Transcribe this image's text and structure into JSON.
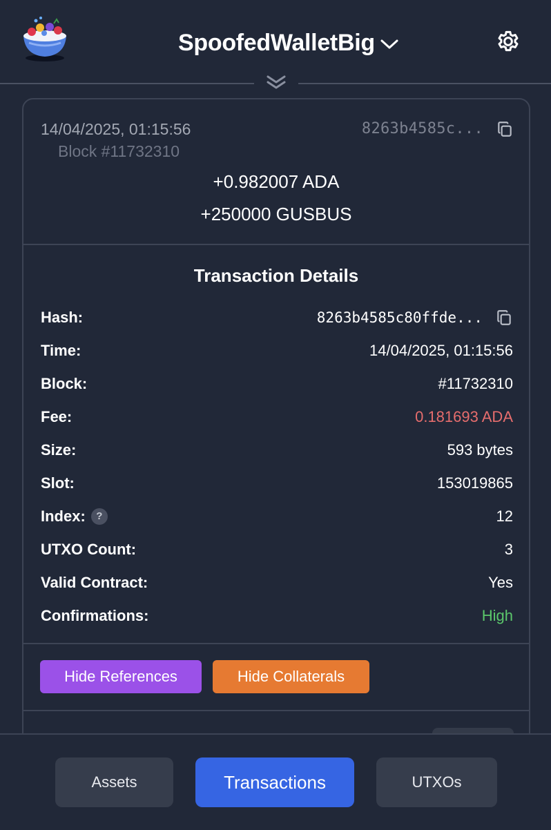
{
  "header": {
    "wallet_name": "SpoofedWalletBig",
    "icons": {
      "logo": "bowl-logo",
      "switch": "chevron-down-icon",
      "settings": "gear-icon",
      "collapse": "double-chevron-down-icon"
    }
  },
  "transaction": {
    "time": "14/04/2025, 01:15:56",
    "block": "Block #11732310",
    "hash_short": "8263b4585c...",
    "amounts": [
      "+0.982007 ADA",
      "+250000 GUSBUS"
    ]
  },
  "details": {
    "title": "Transaction Details",
    "rows": [
      {
        "label": "Hash:",
        "value": "8263b4585c80ffde..."
      },
      {
        "label": "Time:",
        "value": "14/04/2025, 01:15:56"
      },
      {
        "label": "Block:",
        "value": "#11732310"
      },
      {
        "label": "Fee:",
        "value": "0.181693 ADA"
      },
      {
        "label": "Size:",
        "value": "593 bytes"
      },
      {
        "label": "Slot:",
        "value": "153019865"
      },
      {
        "label": "Index:",
        "value": "12",
        "help": "?"
      },
      {
        "label": "UTXO Count:",
        "value": "3"
      },
      {
        "label": "Valid Contract:",
        "value": "Yes"
      },
      {
        "label": "Confirmations:",
        "value": "High"
      }
    ]
  },
  "actions": {
    "hide_references": "Hide References",
    "hide_collaterals": "Hide Collaterals"
  },
  "nav": {
    "tabs": [
      "Assets",
      "Transactions",
      "UTXOs"
    ],
    "active": "Transactions"
  },
  "colors": {
    "background": "#212838",
    "fee": "#e66d6d",
    "confirmations": "#5bc76b",
    "references_button": "#9b51e8",
    "collaterals_button": "#e67a32",
    "active_tab": "#3665e3"
  }
}
